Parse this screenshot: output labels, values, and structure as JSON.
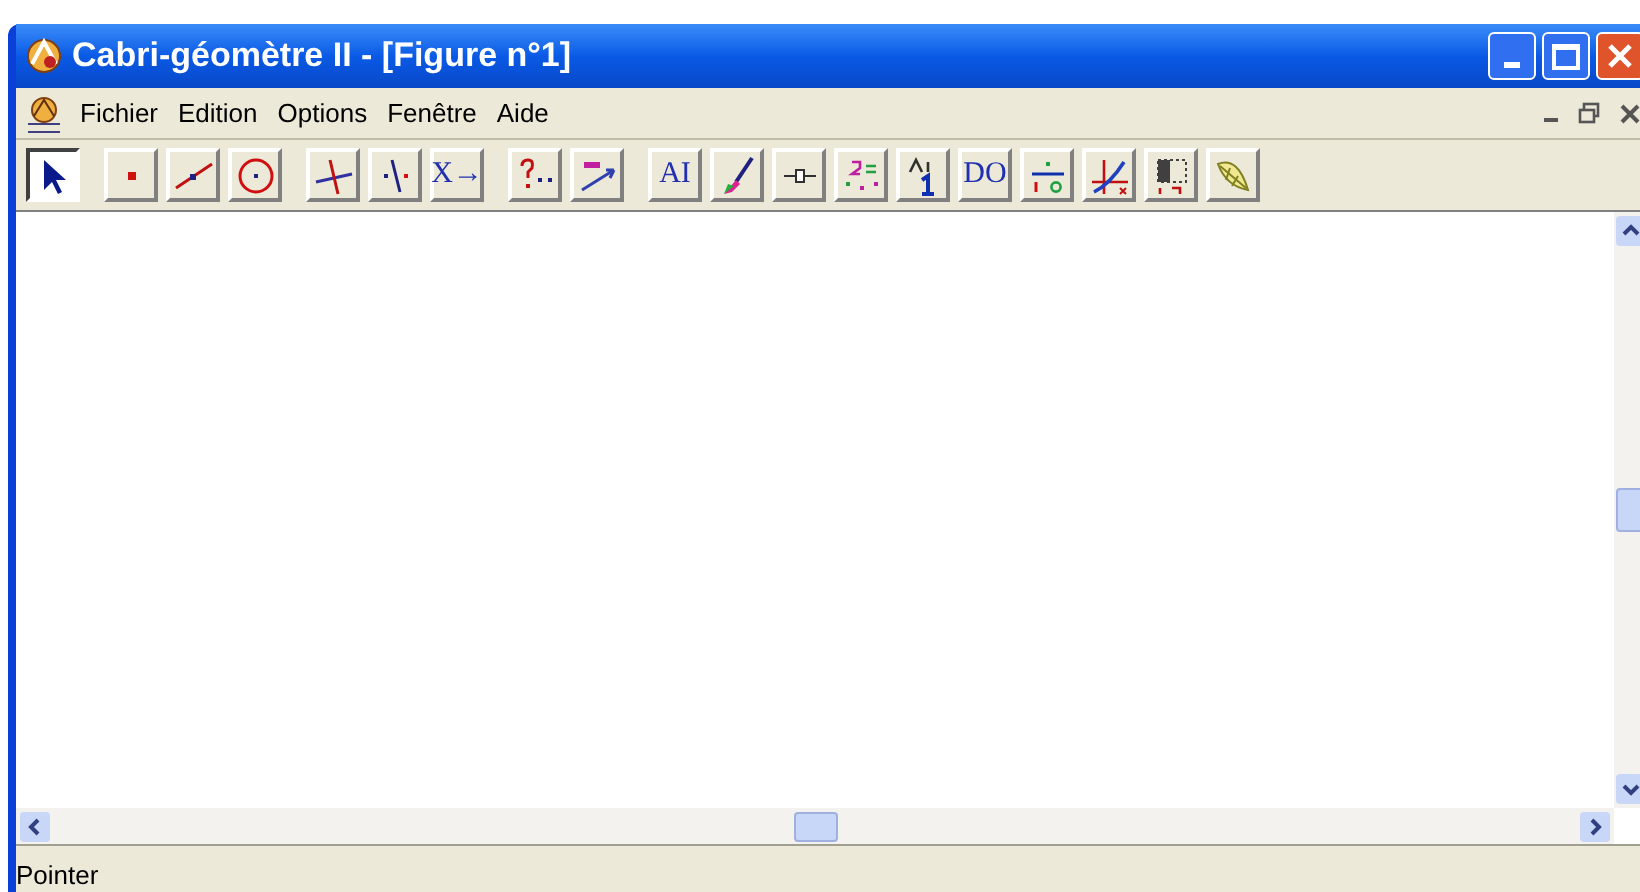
{
  "window": {
    "title": "Cabri-géomètre II - [Figure n°1]"
  },
  "menu": [
    "Fichier",
    "Edition",
    "Options",
    "Fenêtre",
    "Aide"
  ],
  "tools": [
    {
      "kind": "pointer",
      "selected": true
    },
    {
      "kind": "point",
      "selected": false
    },
    {
      "kind": "line",
      "selected": false
    },
    {
      "kind": "circle",
      "selected": false
    },
    {
      "kind": "perpendicular",
      "selected": false
    },
    {
      "kind": "symmetry",
      "selected": false
    },
    {
      "kind": "glyph",
      "glyph": "X→",
      "selected": false
    },
    {
      "kind": "check",
      "selected": false
    },
    {
      "kind": "measure",
      "selected": false
    },
    {
      "kind": "glyph",
      "glyph": "AI",
      "selected": false
    },
    {
      "kind": "brush",
      "selected": false
    },
    {
      "kind": "slider",
      "selected": false
    },
    {
      "kind": "calc",
      "selected": false
    },
    {
      "kind": "label",
      "selected": false
    },
    {
      "kind": "glyph",
      "glyph": "DO",
      "selected": false
    },
    {
      "kind": "numbers",
      "selected": false
    },
    {
      "kind": "axes",
      "selected": false
    },
    {
      "kind": "frame",
      "selected": false
    },
    {
      "kind": "leaf",
      "selected": false
    }
  ],
  "status_bar": "Pointer"
}
